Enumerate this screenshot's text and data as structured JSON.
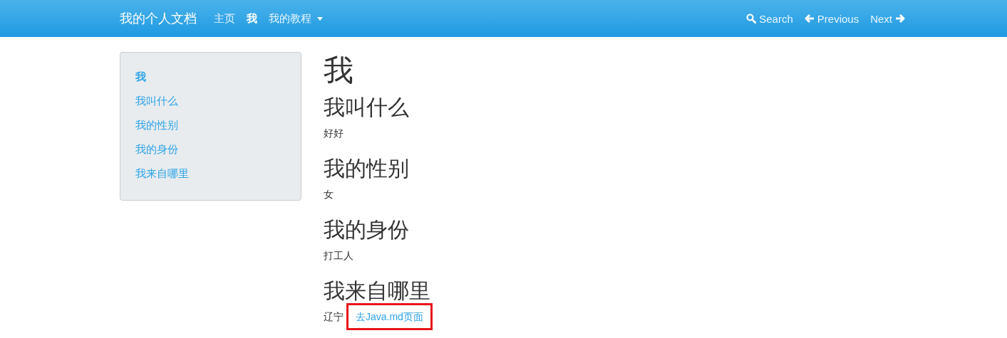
{
  "navbar": {
    "brand": "我的个人文档",
    "items": [
      {
        "label": "主页",
        "selected": false,
        "dropdown": false
      },
      {
        "label": "我",
        "selected": true,
        "dropdown": false
      },
      {
        "label": "我的教程",
        "selected": false,
        "dropdown": true
      }
    ],
    "right": [
      {
        "kind": "search",
        "label": "Search"
      },
      {
        "kind": "previous",
        "label": "Previous"
      },
      {
        "kind": "next",
        "label": "Next"
      }
    ]
  },
  "sidebar": {
    "items": [
      {
        "label": "我",
        "selected": true
      },
      {
        "label": "我叫什么",
        "selected": false
      },
      {
        "label": "我的性别",
        "selected": false
      },
      {
        "label": "我的身份",
        "selected": false
      },
      {
        "label": "我来自哪里",
        "selected": false
      }
    ]
  },
  "content": {
    "title": "我",
    "sections": [
      {
        "heading": "我叫什么",
        "text": "好好"
      },
      {
        "heading": "我的性别",
        "text": "女"
      },
      {
        "heading": "我的身份",
        "text": "打工人"
      },
      {
        "heading": "我来自哪里",
        "text": "辽宁",
        "link": "去Java.md页面",
        "highlighted": true
      }
    ]
  }
}
